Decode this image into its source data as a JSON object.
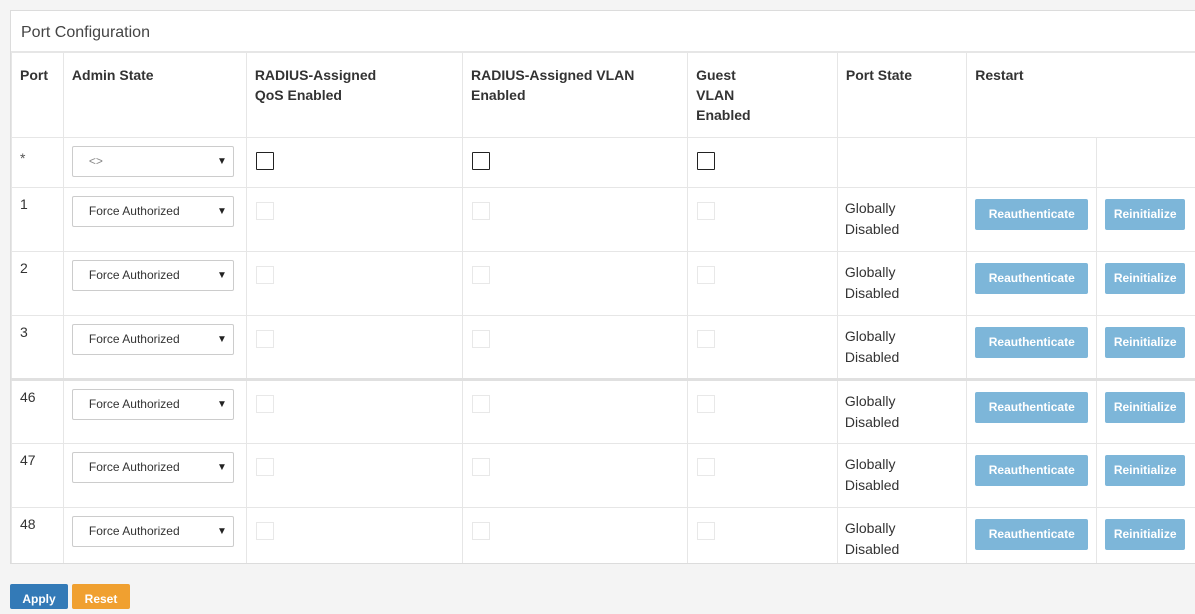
{
  "panel": {
    "title": "Port Configuration"
  },
  "columns": {
    "port": "Port",
    "admin_state": "Admin State",
    "qos": "RADIUS-Assigned QoS Enabled",
    "vlan": "RADIUS-Assigned VLAN Enabled",
    "guest": "Guest VLAN Enabled",
    "port_state": "Port State",
    "restart": "Restart"
  },
  "star_row": {
    "port": "*",
    "admin_state": "<>",
    "qos": false,
    "vlan": false,
    "guest": false
  },
  "rows": [
    {
      "port": "1",
      "admin_state": "Force Authorized",
      "port_state_line1": "Globally",
      "port_state_line2": "Disabled",
      "reauth": "Reauthenticate",
      "reinit": "Reinitialize"
    },
    {
      "port": "2",
      "admin_state": "Force Authorized",
      "port_state_line1": "Globally",
      "port_state_line2": "Disabled",
      "reauth": "Reauthenticate",
      "reinit": "Reinitialize"
    },
    {
      "port": "3",
      "admin_state": "Force Authorized",
      "port_state_line1": "Globally",
      "port_state_line2": "Disabled",
      "reauth": "Reauthenticate",
      "reinit": "Reinitialize"
    },
    {
      "port": "46",
      "admin_state": "Force Authorized",
      "port_state_line1": "Globally",
      "port_state_line2": "Disabled",
      "reauth": "Reauthenticate",
      "reinit": "Reinitialize"
    },
    {
      "port": "47",
      "admin_state": "Force Authorized",
      "port_state_line1": "Globally",
      "port_state_line2": "Disabled",
      "reauth": "Reauthenticate",
      "reinit": "Reinitialize"
    },
    {
      "port": "48",
      "admin_state": "Force Authorized",
      "port_state_line1": "Globally",
      "port_state_line2": "Disabled",
      "reauth": "Reauthenticate",
      "reinit": "Reinitialize"
    }
  ],
  "footer": {
    "apply": "Apply",
    "reset": "Reset"
  },
  "colors": {
    "button_light": "#7db6d9",
    "apply": "#337ab7",
    "reset": "#f0a030"
  }
}
